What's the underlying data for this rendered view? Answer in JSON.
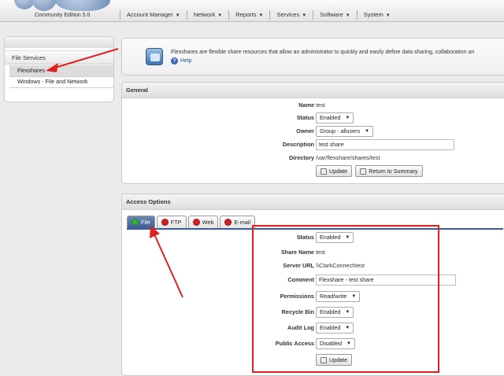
{
  "header": {
    "edition": "Community Edition 5.0",
    "menu": [
      {
        "label": "Account Manager"
      },
      {
        "label": "Network"
      },
      {
        "label": "Reports"
      },
      {
        "label": "Services"
      },
      {
        "label": "Software"
      },
      {
        "label": "System"
      }
    ]
  },
  "sidebar": {
    "section": "File Services",
    "items": [
      {
        "label": "Flexshares",
        "active": true
      },
      {
        "label": "Windows - File and Network",
        "active": false
      }
    ]
  },
  "info": {
    "text": "Flexshares are flexible share resources that allow an administrator to quickly and easily define data sharing, collaboration an",
    "help_label": "Help"
  },
  "general": {
    "title": "General",
    "name_label": "Name",
    "name_value": "test",
    "status_label": "Status",
    "status_value": "Enabled",
    "owner_label": "Owner",
    "owner_value": "Group - allusers",
    "description_label": "Description",
    "description_value": "test share",
    "directory_label": "Directory",
    "directory_value": "/var/flexshare/shares/test",
    "update_label": "Update",
    "return_label": "Return to Summary"
  },
  "access": {
    "title": "Access Options",
    "tabs": [
      {
        "label": "File",
        "active": true,
        "color": "#2fb52f"
      },
      {
        "label": "FTP",
        "active": false,
        "color": "#d42020"
      },
      {
        "label": "Web",
        "active": false,
        "color": "#d42020"
      },
      {
        "label": "E-mail",
        "active": false,
        "color": "#d42020"
      }
    ],
    "status_label": "Status",
    "status_value": "Enabled",
    "share_name_label": "Share Name",
    "share_name_value": "test",
    "server_url_label": "Server URL",
    "server_url_value": "\\\\ClarkConnect\\test",
    "comment_label": "Comment",
    "comment_value": "Flexshare - test share",
    "permissions_label": "Permissions",
    "permissions_value": "Read/write",
    "recycle_bin_label": "Recycle Bin",
    "recycle_bin_value": "Enabled",
    "audit_log_label": "Audit Log",
    "audit_log_value": "Enabled",
    "public_access_label": "Public Access",
    "public_access_value": "Disabled",
    "update_label": "Update"
  },
  "colors": {
    "annotation": "#e02020",
    "tab_active": "#3c5d96"
  }
}
